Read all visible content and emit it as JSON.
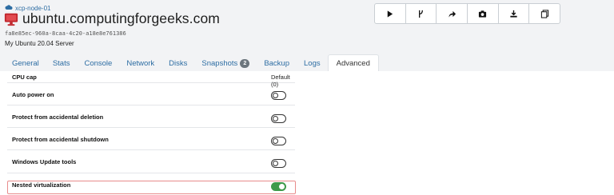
{
  "header": {
    "pool_name": "xcp-node-01",
    "vm_name": "ubuntu.computingforgeeks.com",
    "uuid": "fa8e85ec-960a-8caa-4c20-a18e8e761386",
    "description": "My Ubuntu 20.04 Server",
    "pool_icon": "cloud-icon",
    "vm_icon": "monitor-icon",
    "vm_icon_color": "#c0272d"
  },
  "toolbar": {
    "buttons": [
      {
        "name": "start",
        "icon": "play-icon"
      },
      {
        "name": "start-on-host",
        "icon": "fork-icon"
      },
      {
        "name": "migrate",
        "icon": "share-arrow-icon"
      },
      {
        "name": "snapshot",
        "icon": "camera-icon"
      },
      {
        "name": "export",
        "icon": "download-icon"
      },
      {
        "name": "copy",
        "icon": "copy-icon"
      }
    ]
  },
  "tabs": [
    {
      "label": "General"
    },
    {
      "label": "Stats"
    },
    {
      "label": "Console"
    },
    {
      "label": "Network"
    },
    {
      "label": "Disks"
    },
    {
      "label": "Snapshots",
      "badge": "2"
    },
    {
      "label": "Backup"
    },
    {
      "label": "Logs"
    },
    {
      "label": "Advanced",
      "active": true
    }
  ],
  "settings": [
    {
      "label": "CPU cap",
      "value": "Default (0)"
    },
    {
      "label": "Auto power on",
      "toggle": "off"
    },
    {
      "label": "Protect from accidental deletion",
      "toggle": "off"
    },
    {
      "label": "Protect from accidental shutdown",
      "toggle": "off"
    },
    {
      "label": "Windows Update tools",
      "toggle": "off"
    },
    {
      "label": "Nested virtualization",
      "toggle": "on",
      "highlighted": true
    }
  ],
  "colors": {
    "link": "#2d6da3",
    "toggle_on": "#3e9a4a",
    "highlight_border": "#e88c8c"
  }
}
